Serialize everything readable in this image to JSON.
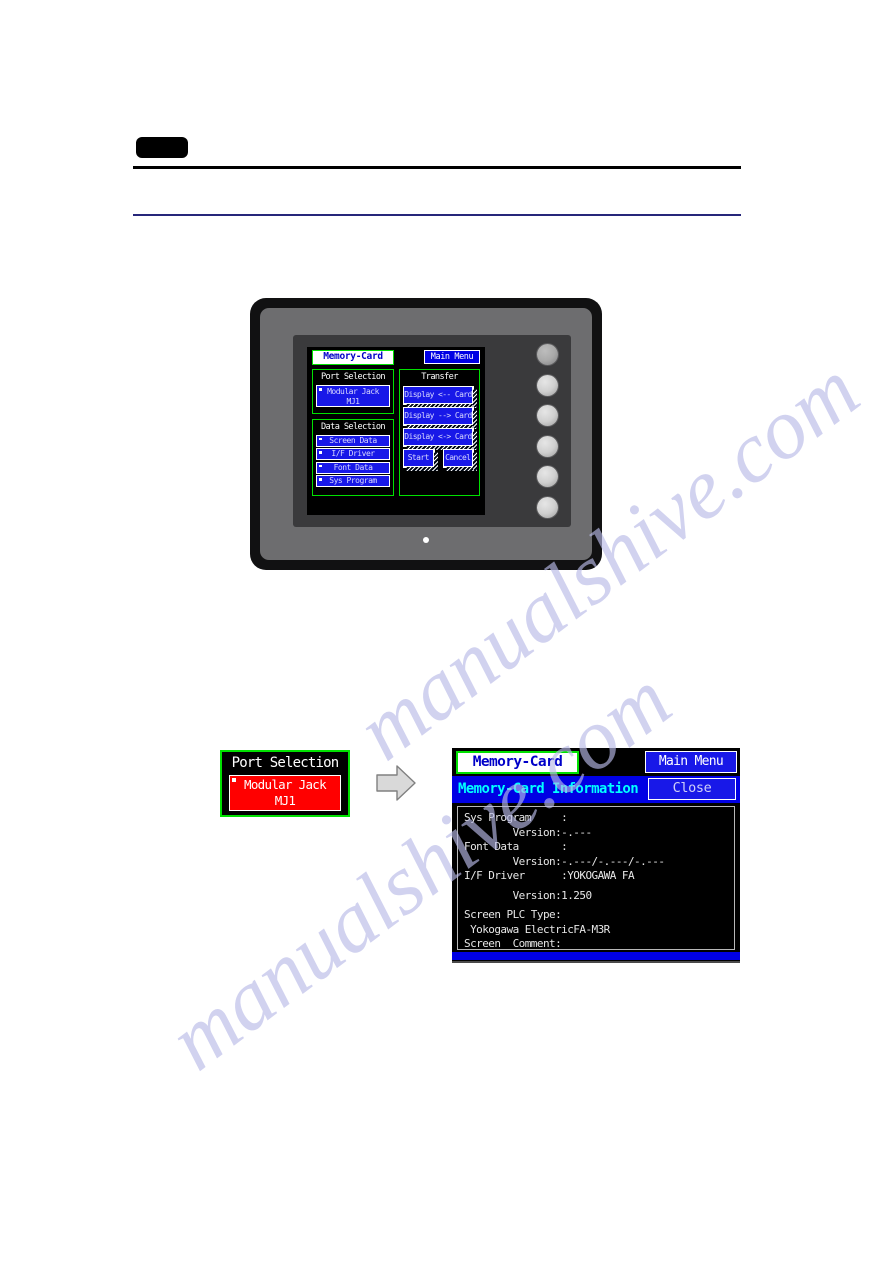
{
  "page": {
    "background_color": "#ffffff",
    "header": {
      "chapter_tab_color": "#000000",
      "rule_color": "#000000",
      "accent_rule_color": "#26267a"
    },
    "watermark": {
      "line1": "manualshive.com",
      "line2": "manualshive.com",
      "color": "#b9bbe8"
    }
  },
  "colors": {
    "screen_green_border": "#00e000",
    "screen_blue": "#1818e8",
    "screen_blue_solid": "#0000e4",
    "screen_red_selected": "#ff0000",
    "screen_cyan_text": "#00ffff",
    "screen_title_text": "#0000c8",
    "bezel_dark": "#111112",
    "bezel_gray": "#6d6d6f"
  },
  "device": {
    "name": "hmi-operator-panel",
    "side_buttons_count": 6,
    "led_indicator": "power-led",
    "screen": {
      "title": "Memory-Card",
      "main_menu_button": "Main Menu",
      "port_selection": {
        "heading": "Port Selection",
        "items": [
          {
            "line1": "Modular Jack",
            "line2": "MJ1",
            "selected": false
          }
        ]
      },
      "data_selection": {
        "heading": "Data Selection",
        "items": [
          {
            "label": "Screen Data"
          },
          {
            "label": "I/F Driver"
          },
          {
            "label": "Font Data"
          },
          {
            "label": "Sys Program"
          }
        ]
      },
      "transfer": {
        "heading": "Transfer",
        "buttons": [
          {
            "label": "Display <-- Card"
          },
          {
            "label": "Display --> Card"
          },
          {
            "label": "Display <-> Card"
          }
        ],
        "actions": [
          {
            "label": "Start"
          },
          {
            "label": "Cancel"
          }
        ]
      }
    }
  },
  "callout": {
    "port_selection": {
      "heading": "Port Selection",
      "item_line1": "Modular Jack",
      "item_line2": "MJ1",
      "state": "selected"
    },
    "arrow": "arrow-right-icon"
  },
  "info_screen": {
    "title": "Memory-Card",
    "main_menu_button": "Main Menu",
    "subtitle": "Memory-Card Information",
    "close_button": "Close",
    "lines": [
      "Sys Program     :",
      "        Version:-.---",
      "Font Data       :",
      "        Version:-.---/-.---/-.---",
      "I/F Driver      :YOKOGAWA FA",
      "",
      "        Version:1.250",
      "",
      "Screen PLC Type:",
      " Yokogawa ElectricFA-M3R",
      "Screen  Comment:"
    ]
  }
}
